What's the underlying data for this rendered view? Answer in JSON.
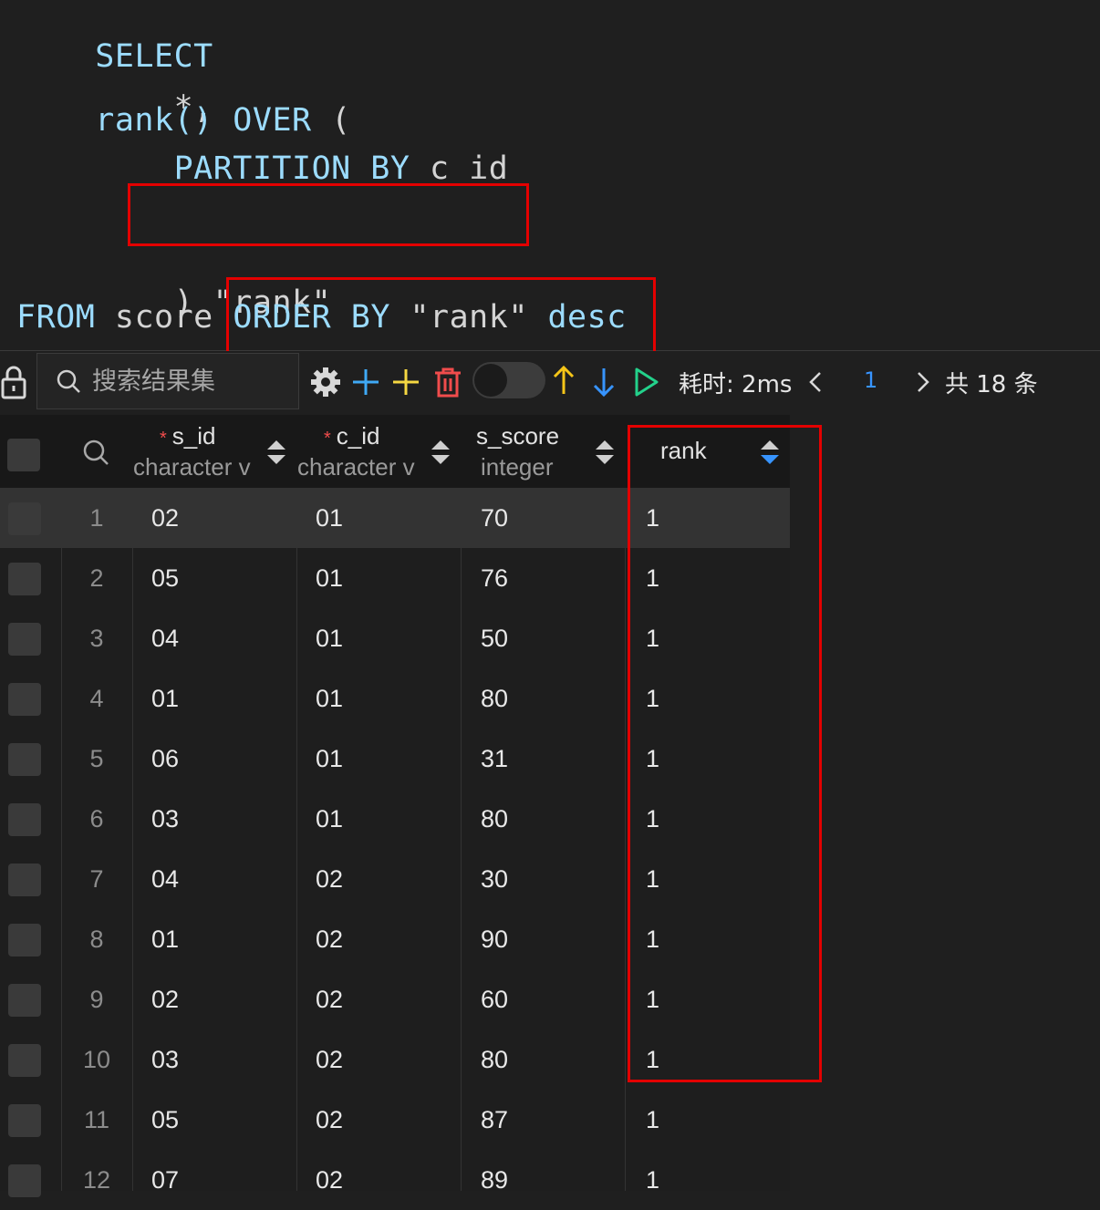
{
  "editor": {
    "lines": [
      [
        "SELECT"
      ],
      [
        "    *,"
      ],
      [
        "    rank() ",
        "OVER",
        " ("
      ],
      [
        "        ",
        "PARTITION BY",
        " c_id"
      ],
      [
        ""
      ],
      [
        "    ) \"rank\""
      ],
      [
        "FROM",
        " score ",
        "ORDER BY",
        " \"rank\" ",
        "desc"
      ]
    ]
  },
  "toolbar": {
    "search_placeholder": "搜索结果集",
    "time_label": "耗时: 2ms",
    "page_number": "1",
    "total_label": "共 18 条",
    "icon_colors": {
      "add": "#3fa9f5",
      "add_row": "#f5d742",
      "delete": "#f14c4c",
      "up": "#f5c518",
      "down": "#3794ff",
      "run": "#23d18b"
    }
  },
  "grid": {
    "columns": [
      {
        "name": "s_id",
        "type": "character v",
        "required": true
      },
      {
        "name": "c_id",
        "type": "character v",
        "required": true
      },
      {
        "name": "s_score",
        "type": "integer",
        "required": false
      },
      {
        "name": "rank",
        "type": "",
        "required": false
      }
    ],
    "rows": [
      {
        "n": "1",
        "s_id": "02",
        "c_id": "01",
        "s_score": "70",
        "rank": "1"
      },
      {
        "n": "2",
        "s_id": "05",
        "c_id": "01",
        "s_score": "76",
        "rank": "1"
      },
      {
        "n": "3",
        "s_id": "04",
        "c_id": "01",
        "s_score": "50",
        "rank": "1"
      },
      {
        "n": "4",
        "s_id": "01",
        "c_id": "01",
        "s_score": "80",
        "rank": "1"
      },
      {
        "n": "5",
        "s_id": "06",
        "c_id": "01",
        "s_score": "31",
        "rank": "1"
      },
      {
        "n": "6",
        "s_id": "03",
        "c_id": "01",
        "s_score": "80",
        "rank": "1"
      },
      {
        "n": "7",
        "s_id": "04",
        "c_id": "02",
        "s_score": "30",
        "rank": "1"
      },
      {
        "n": "8",
        "s_id": "01",
        "c_id": "02",
        "s_score": "90",
        "rank": "1"
      },
      {
        "n": "9",
        "s_id": "02",
        "c_id": "02",
        "s_score": "60",
        "rank": "1"
      },
      {
        "n": "10",
        "s_id": "03",
        "c_id": "02",
        "s_score": "80",
        "rank": "1"
      },
      {
        "n": "11",
        "s_id": "05",
        "c_id": "02",
        "s_score": "87",
        "rank": "1"
      },
      {
        "n": "12",
        "s_id": "07",
        "c_id": "02",
        "s_score": "89",
        "rank": "1"
      }
    ]
  }
}
